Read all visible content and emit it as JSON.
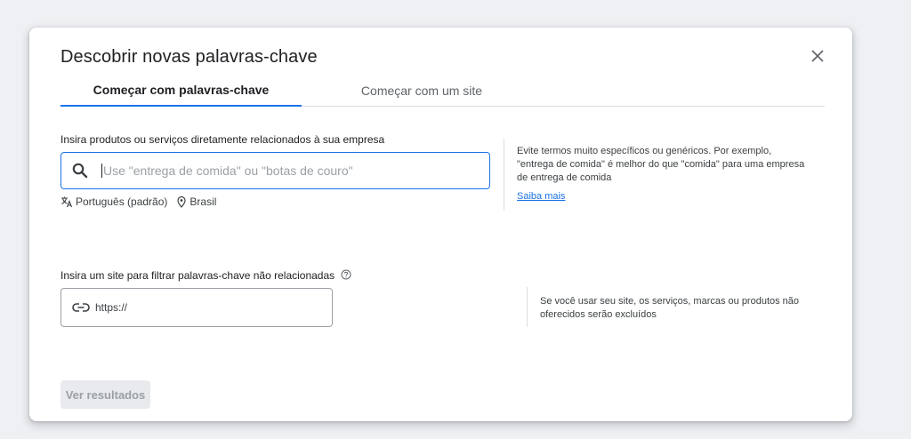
{
  "dialog": {
    "title": "Descobrir novas palavras-chave",
    "close_icon": "close-icon"
  },
  "tabs": [
    {
      "label": "Começar com palavras-chave",
      "active": true
    },
    {
      "label": "Começar com um site",
      "active": false
    }
  ],
  "keywords": {
    "label": "Insira produtos ou serviços diretamente relacionados à sua empresa",
    "placeholder": "Use \"entrega de comida\" ou \"botas de couro\"",
    "language": "Português (padrão)",
    "location": "Brasil",
    "hint": [
      "Evite termos muito específicos ou genéricos. Por exemplo,",
      "\"entrega de comida\" é melhor do que \"comida\" para uma empresa",
      "de entrega de comida"
    ],
    "learn_more": "Saiba mais"
  },
  "site": {
    "label": "Insira um site para filtrar palavras-chave não relacionadas",
    "placeholder": "https://",
    "hint": [
      "Se você usar seu site, os serviços, marcas ou produtos não",
      "oferecidos serão excluídos"
    ]
  },
  "actions": {
    "results_label": "Ver resultados",
    "results_enabled": false
  },
  "colors": {
    "accent": "#1a73e8",
    "background": "#eef0f3",
    "disabled_bg": "#e8eaed",
    "disabled_text": "#9aa0a6"
  }
}
